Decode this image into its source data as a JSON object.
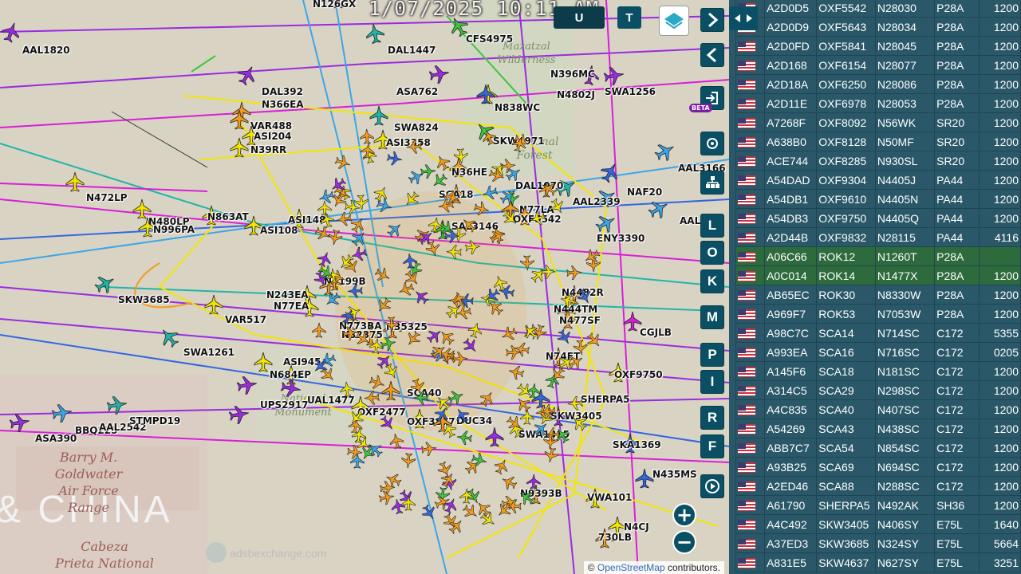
{
  "clock": "1/07/2025 10:11 AM",
  "attribution": {
    "prefix": "©",
    "link": "OpenStreetMap",
    "suffix": "contributors."
  },
  "watermark": "adsbexchange.com",
  "map_labels": {
    "big_text": "& CHINA",
    "goldwater": "Barry M.\nGoldwater\nAir Force\nRange",
    "cabeza": "Cabeza\nPrieta National",
    "mazatzal": "Mazatzal\nWilderness",
    "forest": "National\nForest",
    "monument": "National\nMonument"
  },
  "colors": {
    "yellow": "#f2e600",
    "orange": "#f29c1a",
    "green": "#3ec53e",
    "teal": "#1fb5a8",
    "cyan": "#3aa6e8",
    "blue": "#3367e0",
    "purple": "#9a2be0",
    "magenta": "#d81fd8",
    "lime": "#9ed81f",
    "panel_bg": "#2a5869",
    "button_bg": "#0a4f63"
  },
  "top_buttons": {
    "u": "U",
    "t": "T",
    "extra": "80"
  },
  "side_buttons": [
    "L",
    "O",
    "K",
    "M",
    "P",
    "I",
    "R",
    "F"
  ],
  "side_icons": [
    "chevron-right-icon",
    "chevron-left-icon",
    "login-icon",
    "gear-icon",
    "filter-icon",
    "replay-icon"
  ],
  "beta_badge": "BETA",
  "zoom": {
    "in": "+",
    "out": "−"
  },
  "aircraft": [
    {
      "label": "AAL1820",
      "color": "purple",
      "rot": 20
    },
    {
      "label": "N126GX",
      "color": "purple",
      "rot": 0
    },
    {
      "label": "CFS4975",
      "color": "green",
      "rot": -30
    },
    {
      "label": "N396MC",
      "color": "purple",
      "rot": 10
    },
    {
      "label": "DAL1447",
      "color": "teal",
      "rot": -10
    },
    {
      "label": "ASA762",
      "color": "purple",
      "rot": 80
    },
    {
      "label": "DAL392",
      "color": "purple",
      "rot": 30
    },
    {
      "label": "N366EA",
      "color": "orange",
      "rot": 0
    },
    {
      "label": "N4802J",
      "color": "yellow",
      "rot": 0
    },
    {
      "label": "SWA1256",
      "color": "purple",
      "rot": 80
    },
    {
      "label": "N838WC",
      "color": "blue",
      "rot": 0
    },
    {
      "label": "VAR488",
      "color": "orange",
      "rot": 0
    },
    {
      "label": "ASI204",
      "color": "yellow",
      "rot": 0
    },
    {
      "label": "N39RR",
      "color": "yellow",
      "rot": 0
    },
    {
      "label": "SWA824",
      "color": "teal",
      "rot": 0
    },
    {
      "label": "ASI3358",
      "color": "yellow",
      "rot": 0
    },
    {
      "label": "SKW4971",
      "color": "green",
      "rot": -40
    },
    {
      "label": "AAL3166",
      "color": "cyan",
      "rot": 60
    },
    {
      "label": "N36HE",
      "color": "orange",
      "rot": 0
    },
    {
      "label": "N472LP",
      "color": "yellow",
      "rot": 0
    },
    {
      "label": "DAL1070",
      "color": "teal",
      "rot": 60
    },
    {
      "label": "NAF20",
      "color": "blue",
      "rot": 30
    },
    {
      "label": "AAL2339",
      "color": "cyan",
      "rot": 60
    },
    {
      "label": "N480LP",
      "color": "yellow",
      "rot": 0
    },
    {
      "label": "N863AT",
      "color": "yellow",
      "rot": 0
    },
    {
      "label": "N996PA",
      "color": "yellow",
      "rot": 0
    },
    {
      "label": "ASI148",
      "color": "yellow",
      "rot": 0
    },
    {
      "label": "SCA18",
      "color": "orange",
      "rot": 0
    },
    {
      "label": "N77LA",
      "color": "orange",
      "rot": 0
    },
    {
      "label": "OXF5542",
      "color": "orange",
      "rot": 0
    },
    {
      "label": "ASI108",
      "color": "yellow",
      "rot": 0
    },
    {
      "label": "ENY3390",
      "color": "cyan",
      "rot": 60
    },
    {
      "label": "AAL",
      "color": "cyan",
      "rot": 60
    },
    {
      "label": "SAL3146",
      "color": "green",
      "rot": 0
    },
    {
      "label": "N5199B",
      "color": "orange",
      "rot": 0
    },
    {
      "label": "SKW3685",
      "color": "teal",
      "rot": 60
    },
    {
      "label": "N243EA",
      "color": "yellow",
      "rot": 0
    },
    {
      "label": "N77EA",
      "color": "yellow",
      "rot": 0
    },
    {
      "label": "VAR517",
      "color": "yellow",
      "rot": 0
    },
    {
      "label": "N4482R",
      "color": "orange",
      "rot": 0
    },
    {
      "label": "N444TM",
      "color": "orange",
      "rot": 0
    },
    {
      "label": "N477SF",
      "color": "orange",
      "rot": 0
    },
    {
      "label": "N773BA",
      "color": "orange",
      "rot": 0
    },
    {
      "label": "N35325",
      "color": "orange",
      "rot": 0
    },
    {
      "label": "N32375",
      "color": "orange",
      "rot": 0
    },
    {
      "label": "CGJLB",
      "color": "magenta",
      "rot": 0
    },
    {
      "label": "SWA1261",
      "color": "teal",
      "rot": -40
    },
    {
      "label": "ASI945",
      "color": "yellow",
      "rot": 0
    },
    {
      "label": "N684EP",
      "color": "yellow",
      "rot": 0
    },
    {
      "label": "N74FT",
      "color": "orange",
      "rot": 0
    },
    {
      "label": "OXF9750",
      "color": "yellow",
      "rot": 0
    },
    {
      "label": "UPS2917",
      "color": "purple",
      "rot": 80
    },
    {
      "label": "UAL1477",
      "color": "purple",
      "rot": 100
    },
    {
      "label": "SCA40",
      "color": "orange",
      "rot": 0
    },
    {
      "label": "SHERPA5",
      "color": "blue",
      "rot": 0
    },
    {
      "label": "OXF2477",
      "color": "yellow",
      "rot": 0
    },
    {
      "label": "OXF3877",
      "color": "yellow",
      "rot": 0
    },
    {
      "label": "DUC34",
      "color": "orange",
      "rot": 0
    },
    {
      "label": "SKW3405",
      "color": "purple",
      "rot": 0
    },
    {
      "label": "SWA1315",
      "color": "purple",
      "rot": 0
    },
    {
      "label": "ASA390",
      "color": "purple",
      "rot": 80
    },
    {
      "label": "BBQ225",
      "color": "cyan",
      "rot": 80
    },
    {
      "label": "AAL2542",
      "color": "teal",
      "rot": 80
    },
    {
      "label": "STMPD19",
      "color": "purple",
      "rot": 80
    },
    {
      "label": "SKA1369",
      "color": "blue",
      "rot": 0
    },
    {
      "label": "N9393B",
      "color": "orange",
      "rot": 0
    },
    {
      "label": "N435MS",
      "color": "blue",
      "rot": 0
    },
    {
      "label": "VWA101",
      "color": "yellow",
      "rot": 0
    },
    {
      "label": "N4CJ",
      "color": "yellow",
      "rot": 0
    },
    {
      "label": "730LB",
      "color": "orange",
      "rot": 0
    }
  ],
  "table": {
    "rows": [
      {
        "hex": "A2D0D5",
        "call": "OXF5542",
        "reg": "N28030",
        "type": "P28A",
        "sq": "1200",
        "hl": false
      },
      {
        "hex": "A2D0D9",
        "call": "OXF5643",
        "reg": "N28034",
        "type": "P28A",
        "sq": "1200",
        "hl": false
      },
      {
        "hex": "A2D0FD",
        "call": "OXF5841",
        "reg": "N28045",
        "type": "P28A",
        "sq": "1200",
        "hl": false
      },
      {
        "hex": "A2D168",
        "call": "OXF6154",
        "reg": "N28077",
        "type": "P28A",
        "sq": "1200",
        "hl": false
      },
      {
        "hex": "A2D18A",
        "call": "OXF6250",
        "reg": "N28086",
        "type": "P28A",
        "sq": "1200",
        "hl": false
      },
      {
        "hex": "A2D11E",
        "call": "OXF6978",
        "reg": "N28053",
        "type": "P28A",
        "sq": "1200",
        "hl": false
      },
      {
        "hex": "A7268F",
        "call": "OXF8092",
        "reg": "N56WK",
        "type": "SR20",
        "sq": "1200",
        "hl": false
      },
      {
        "hex": "A638B0",
        "call": "OXF8128",
        "reg": "N50MF",
        "type": "SR20",
        "sq": "1200",
        "hl": false
      },
      {
        "hex": "ACE744",
        "call": "OXF8285",
        "reg": "N930SL",
        "type": "SR20",
        "sq": "1200",
        "hl": false
      },
      {
        "hex": "A54DAD",
        "call": "OXF9304",
        "reg": "N4405J",
        "type": "PA44",
        "sq": "1200",
        "hl": false
      },
      {
        "hex": "A54DB1",
        "call": "OXF9610",
        "reg": "N4405N",
        "type": "PA44",
        "sq": "1200",
        "hl": false
      },
      {
        "hex": "A54DB3",
        "call": "OXF9750",
        "reg": "N4405Q",
        "type": "PA44",
        "sq": "1200",
        "hl": false
      },
      {
        "hex": "A2D44B",
        "call": "OXF9832",
        "reg": "N28115",
        "type": "PA44",
        "sq": "4116",
        "hl": false
      },
      {
        "hex": "A06C66",
        "call": "ROK12",
        "reg": "N1260T",
        "type": "P28A",
        "sq": "",
        "hl": true
      },
      {
        "hex": "A0C014",
        "call": "ROK14",
        "reg": "N1477X",
        "type": "P28A",
        "sq": "1200",
        "hl": true
      },
      {
        "hex": "AB65EC",
        "call": "ROK30",
        "reg": "N8330W",
        "type": "P28A",
        "sq": "1200",
        "hl": false
      },
      {
        "hex": "A969F7",
        "call": "ROK53",
        "reg": "N7053W",
        "type": "P28A",
        "sq": "1200",
        "hl": false
      },
      {
        "hex": "A98C7C",
        "call": "SCA14",
        "reg": "N714SC",
        "type": "C172",
        "sq": "5355",
        "hl": false
      },
      {
        "hex": "A993EA",
        "call": "SCA16",
        "reg": "N716SC",
        "type": "C172",
        "sq": "0205",
        "hl": false
      },
      {
        "hex": "A145F6",
        "call": "SCA18",
        "reg": "N181SC",
        "type": "C172",
        "sq": "1200",
        "hl": false
      },
      {
        "hex": "A314C5",
        "call": "SCA29",
        "reg": "N298SC",
        "type": "C172",
        "sq": "1200",
        "hl": false
      },
      {
        "hex": "A4C835",
        "call": "SCA40",
        "reg": "N407SC",
        "type": "C172",
        "sq": "1200",
        "hl": false
      },
      {
        "hex": "A54269",
        "call": "SCA43",
        "reg": "N438SC",
        "type": "C172",
        "sq": "1200",
        "hl": false
      },
      {
        "hex": "ABB7C7",
        "call": "SCA54",
        "reg": "N854SC",
        "type": "C172",
        "sq": "1200",
        "hl": false
      },
      {
        "hex": "A93B25",
        "call": "SCA69",
        "reg": "N694SC",
        "type": "C172",
        "sq": "1200",
        "hl": false
      },
      {
        "hex": "A2ED46",
        "call": "SCA88",
        "reg": "N288SC",
        "type": "C172",
        "sq": "1200",
        "hl": false
      },
      {
        "hex": "A61790",
        "call": "SHERPA5",
        "reg": "N492AK",
        "type": "SH36",
        "sq": "1200",
        "hl": false
      },
      {
        "hex": "A4C492",
        "call": "SKW3405",
        "reg": "N406SY",
        "type": "E75L",
        "sq": "1640",
        "hl": false
      },
      {
        "hex": "A37ED3",
        "call": "SKW3685",
        "reg": "N324SY",
        "type": "E75L",
        "sq": "5664",
        "hl": false
      },
      {
        "hex": "A831E5",
        "call": "SKW4637",
        "reg": "N627SY",
        "type": "E75L",
        "sq": "3251",
        "hl": false
      }
    ]
  }
}
